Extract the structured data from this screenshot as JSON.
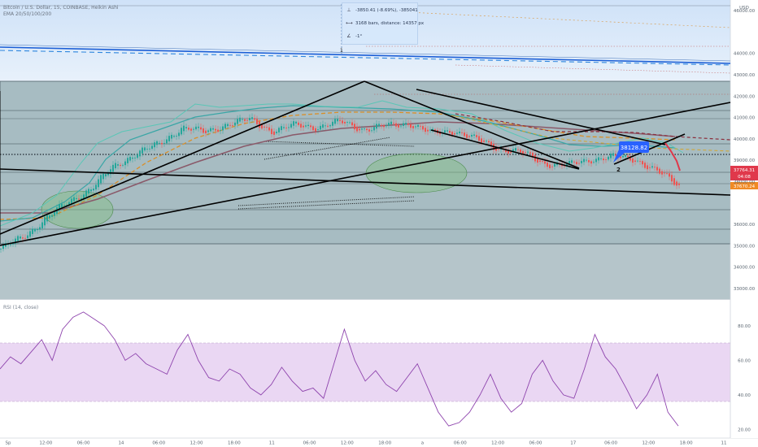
{
  "legend": {
    "symbol": "Bitcoin / U.S. Dollar, 15, COINBASE, Heikin Ashi",
    "ema": "EMA 20/50/100/200"
  },
  "measure_tool": {
    "price_change": "-3850.41 (-8.69%), -385041",
    "bars_distance": "3168 bars, distance: 14357 px",
    "angle": "-1°"
  },
  "currency": "USD",
  "labels": {
    "point1": "1",
    "point2": "2",
    "callout_price": "38128.82",
    "last_price": "37764.31",
    "countdown": "04:08",
    "ma_price": "37670.24",
    "rsi_title": "RSI (14, close)"
  },
  "colors": {
    "accent_blue": "#2962ff",
    "last_price_red": "#e0384b",
    "ma_orange": "#f08a24",
    "rsi_purple": "#8e44ad",
    "candle_up": "#26a69a",
    "candle_down": "#ef5350"
  },
  "chart_data": [
    {
      "type": "line",
      "title": "Bitcoin / U.S. Dollar, 15, COINBASE, Heikin Ashi",
      "ylim": [
        32500,
        46500
      ],
      "y_ticks": [
        "46000.00",
        "44000.00",
        "43000.00",
        "42000.00",
        "41000.00",
        "40000.00",
        "39000.00",
        "38000.00",
        "36000.00",
        "35000.00",
        "34000.00",
        "33000.00"
      ],
      "x_ticks": [
        "Sp",
        "12:00",
        "06:00",
        "14",
        "06:00",
        "12:00",
        "18:00",
        "11",
        "06:00",
        "12:00",
        "18:00",
        "a",
        "06:00",
        "12:00",
        "06:00",
        "17",
        "06:00",
        "12:00",
        "18:00",
        "11"
      ],
      "series": [
        {
          "name": "Bitcoin / U.S. Dollar",
          "values": [
            34850,
            35400,
            36300,
            37050,
            37700,
            38700,
            39350,
            39750,
            40550,
            40300,
            40700,
            40900,
            40350,
            40650,
            40550,
            40800,
            40450,
            40600,
            40750,
            40250,
            40400,
            39950,
            39550,
            39350,
            38850,
            38750,
            39050,
            39150,
            39050,
            38450,
            37764
          ]
        }
      ],
      "last_price": 37764.31
    },
    {
      "type": "line",
      "title": "RSI (14, close)",
      "ylim": [
        15,
        95
      ],
      "y_ticks": [
        "80.00",
        "60.00",
        "40.00",
        "20.00"
      ],
      "series": [
        {
          "name": "RSI",
          "values": [
            55,
            62,
            58,
            65,
            72,
            60,
            78,
            85,
            88,
            84,
            80,
            72,
            60,
            64,
            58,
            55,
            52,
            66,
            75,
            60,
            50,
            48,
            55,
            52,
            44,
            40,
            46,
            56,
            48,
            42,
            44,
            38,
            58,
            78,
            60,
            48,
            54,
            46,
            42,
            50,
            58,
            44,
            30,
            22,
            24,
            30,
            40,
            52,
            38,
            30,
            35,
            52,
            60,
            48,
            40,
            38,
            55,
            75,
            62,
            55,
            44,
            32,
            40,
            52,
            30,
            22
          ]
        }
      ],
      "upper_band": 70,
      "lower_band": 30
    }
  ]
}
